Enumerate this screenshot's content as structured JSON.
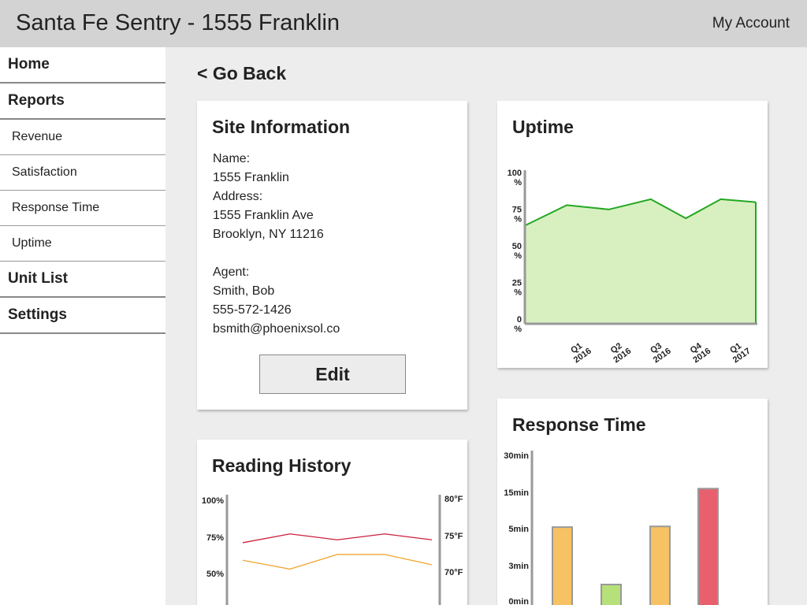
{
  "header": {
    "title": "Santa Fe Sentry - 1555 Franklin",
    "account_label": "My Account"
  },
  "sidebar": {
    "items": [
      {
        "label": "Home"
      },
      {
        "label": "Reports"
      },
      {
        "label": "Revenue"
      },
      {
        "label": "Satisfaction"
      },
      {
        "label": "Response Time"
      },
      {
        "label": "Uptime"
      },
      {
        "label": "Unit List"
      },
      {
        "label": "Settings"
      }
    ]
  },
  "main": {
    "back_label": "< Go Back"
  },
  "site_info": {
    "title": "Site Information",
    "name_label": "Name:",
    "name": "1555 Franklin",
    "address_label": "Address:",
    "address_line1": "1555 Franklin Ave",
    "address_line2": "Brooklyn, NY 11216",
    "agent_label": "Agent:",
    "agent_name": "Smith, Bob",
    "agent_phone": "555-572-1426",
    "agent_email": "bsmith@phoenixsol.co",
    "edit_label": "Edit"
  },
  "colors": {
    "uptime_line": "#22a722",
    "uptime_fill": "#d8f0c0",
    "humidity_line": "#cc1f3a",
    "temperature_line": "#f0a830",
    "bar_orange": "#f7c264",
    "bar_green": "#b6e07a",
    "bar_red": "#e8606e",
    "axis": "#999999"
  },
  "chart_data": [
    {
      "type": "area",
      "title": "Uptime",
      "categories": [
        "Q1 2016",
        "Q2 2016",
        "Q3 2016",
        "Q4 2016",
        "Q1 2017"
      ],
      "y_ticks": [
        "100 %",
        "75 %",
        "50 %",
        "25 %",
        "0 %"
      ],
      "ylim": [
        0,
        100
      ],
      "x_positions": [
        0,
        1.2,
        2.4,
        3.6,
        4.6,
        5.6,
        6.6
      ],
      "values": [
        67,
        81,
        78,
        85,
        72,
        85,
        83
      ]
    },
    {
      "type": "line",
      "title": "Reading History",
      "y_left_ticks": [
        "100%",
        "75%",
        "50%"
      ],
      "y_right_ticks": [
        "80°F",
        "75°F",
        "70°F"
      ],
      "series": [
        {
          "values": [
            71,
            77,
            73,
            77,
            73
          ]
        },
        {
          "values": [
            59,
            53,
            63,
            63,
            56
          ]
        }
      ]
    },
    {
      "type": "bar",
      "title": "Response Time",
      "y_ticks": [
        "30min",
        "15min",
        "5min",
        "3min",
        "0min"
      ],
      "y_tick_values": [
        30,
        15,
        5,
        3,
        0
      ],
      "values": [
        5.4,
        1.4,
        5.6,
        16.5
      ],
      "bar_colors": [
        "#f7c264",
        "#b6e07a",
        "#f7c264",
        "#e8606e"
      ]
    }
  ]
}
